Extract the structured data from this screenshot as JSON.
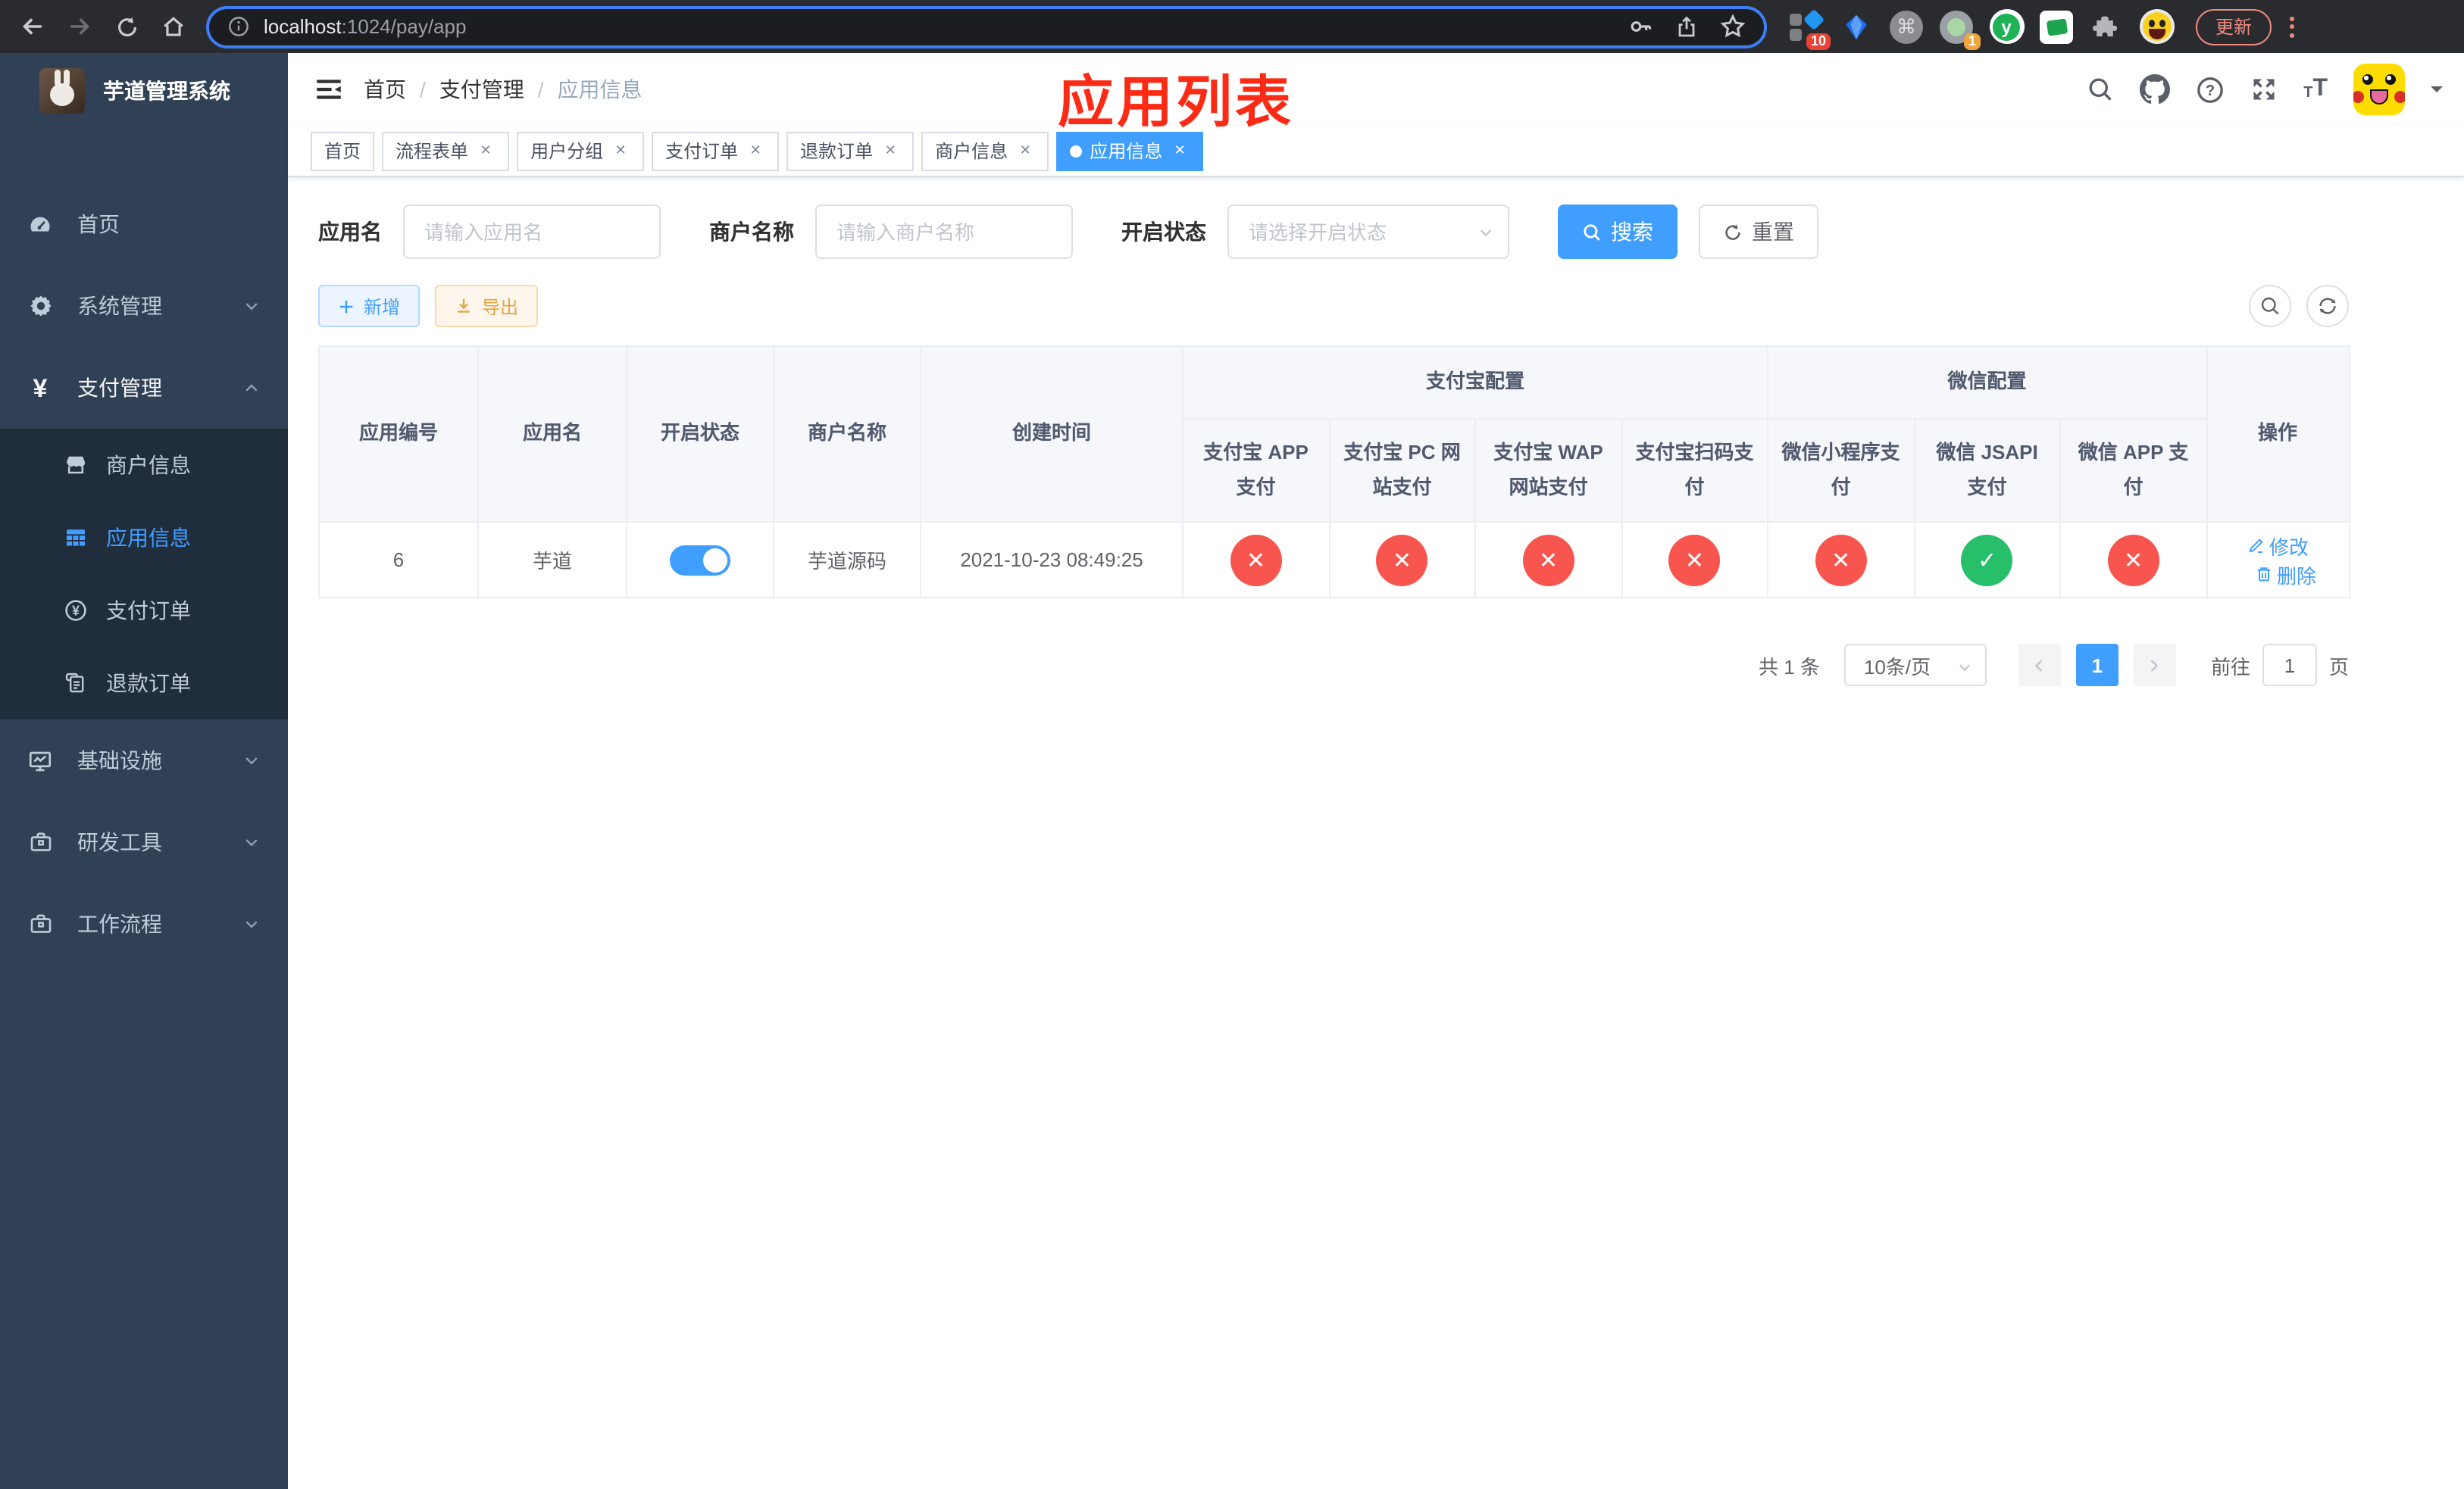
{
  "browser": {
    "url": {
      "host": "localhost",
      "path": ":1024/pay/app"
    },
    "update_button": "更新",
    "extensions": {
      "badge_ten": "10",
      "badge_one": "1",
      "y_letter": "y",
      "cmd_glyph": "⌘"
    }
  },
  "sidebar": {
    "title": "芋道管理系统",
    "items": [
      {
        "label": "首页"
      },
      {
        "label": "系统管理"
      },
      {
        "label": "支付管理"
      },
      {
        "label": "基础设施"
      },
      {
        "label": "研发工具"
      },
      {
        "label": "工作流程"
      }
    ],
    "payment_children": [
      {
        "label": "商户信息"
      },
      {
        "label": "应用信息"
      },
      {
        "label": "支付订单"
      },
      {
        "label": "退款订单"
      }
    ]
  },
  "navbar": {
    "breadcrumb": [
      "首页",
      "支付管理",
      "应用信息"
    ],
    "separator": "/",
    "annotation": "应用列表"
  },
  "tags": [
    {
      "label": "首页"
    },
    {
      "label": "流程表单"
    },
    {
      "label": "用户分组"
    },
    {
      "label": "支付订单"
    },
    {
      "label": "退款订单"
    },
    {
      "label": "商户信息"
    },
    {
      "label": "应用信息"
    }
  ],
  "filters": {
    "app_name_label": "应用名",
    "app_name_placeholder": "请输入应用名",
    "merchant_label": "商户名称",
    "merchant_placeholder": "请输入商户名称",
    "status_label": "开启状态",
    "status_placeholder": "请选择开启状态",
    "search_label": "搜索",
    "reset_label": "重置"
  },
  "toolbar": {
    "add_label": "新增",
    "export_label": "导出"
  },
  "table": {
    "columns": {
      "id": "应用编号",
      "name": "应用名",
      "enabled": "开启状态",
      "merchant": "商户名称",
      "created": "创建时间",
      "actions": "操作"
    },
    "group_headers": {
      "alipay": "支付宝配置",
      "wechat": "微信配置"
    },
    "pay_columns": [
      "支付宝 APP 支付",
      "支付宝 PC 网站支付",
      "支付宝 WAP 网站支付",
      "支付宝扫码支付",
      "微信小程序支付",
      "微信 JSAPI 支付",
      "微信 APP 支付"
    ],
    "rows": [
      {
        "id": "6",
        "name": "芋道",
        "enabled": true,
        "merchant": "芋道源码",
        "created": "2021-10-23 08:49:25",
        "statuses": [
          "x",
          "x",
          "x",
          "x",
          "x",
          "check",
          "x"
        ],
        "edit_label": "修改",
        "delete_label": "删除"
      }
    ]
  },
  "pagination": {
    "total": "共 1 条",
    "page_size": "10条/页",
    "page": "1",
    "goto_label": "前往",
    "goto_value": "1",
    "unit_label": "页"
  },
  "colors": {
    "primary": "#409eff",
    "success": "#28bf6b",
    "danger": "#f7554d",
    "annotation": "#fb2b15",
    "warning": "#e6a23c"
  }
}
